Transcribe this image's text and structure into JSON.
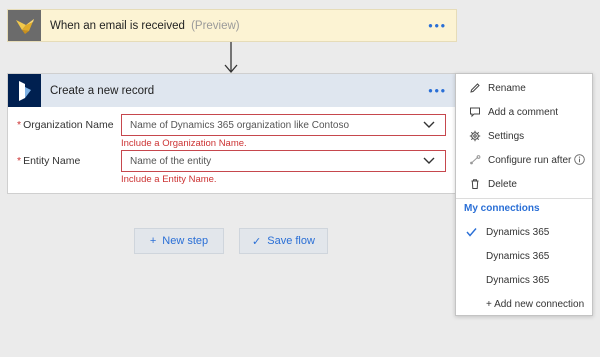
{
  "trigger": {
    "title": "When an email is received",
    "preview": "(Preview)",
    "icon": "email-bird-icon",
    "more_label": "•••"
  },
  "action": {
    "title": "Create a new record",
    "icon": "dynamics-365-icon",
    "more_label": "•••",
    "fields": [
      {
        "required_marker": "*",
        "label": "Organization Name",
        "placeholder": "Name of Dynamics 365 organization like Contoso",
        "error": "Include a Organization Name."
      },
      {
        "required_marker": "*",
        "label": "Entity Name",
        "placeholder": "Name of the entity",
        "error": "Include a Entity Name."
      }
    ]
  },
  "buttons": {
    "new_step": {
      "glyph": "+",
      "label": "New step"
    },
    "save_flow": {
      "glyph": "✓",
      "label": "Save flow"
    }
  },
  "menu": {
    "items": [
      {
        "label": "Rename",
        "icon": "pencil-icon"
      },
      {
        "label": "Add a comment",
        "icon": "comment-icon"
      },
      {
        "label": "Settings",
        "icon": "gear-icon"
      },
      {
        "label": "Configure run after",
        "icon": "run-after-icon"
      },
      {
        "label": "Delete",
        "icon": "trash-icon"
      }
    ],
    "connections_header": "My connections",
    "connections": [
      {
        "label": "Dynamics 365",
        "selected": true
      },
      {
        "label": "Dynamics 365",
        "selected": false
      },
      {
        "label": "Dynamics 365",
        "selected": false
      }
    ],
    "add_connection": "+ Add new connection"
  },
  "colors": {
    "accent": "#2a6fd6",
    "error": "#c33333",
    "trigger_bg": "#fcf3d3",
    "action_header_bg": "#dfe6ef",
    "dynamics_navy": "#002050"
  }
}
